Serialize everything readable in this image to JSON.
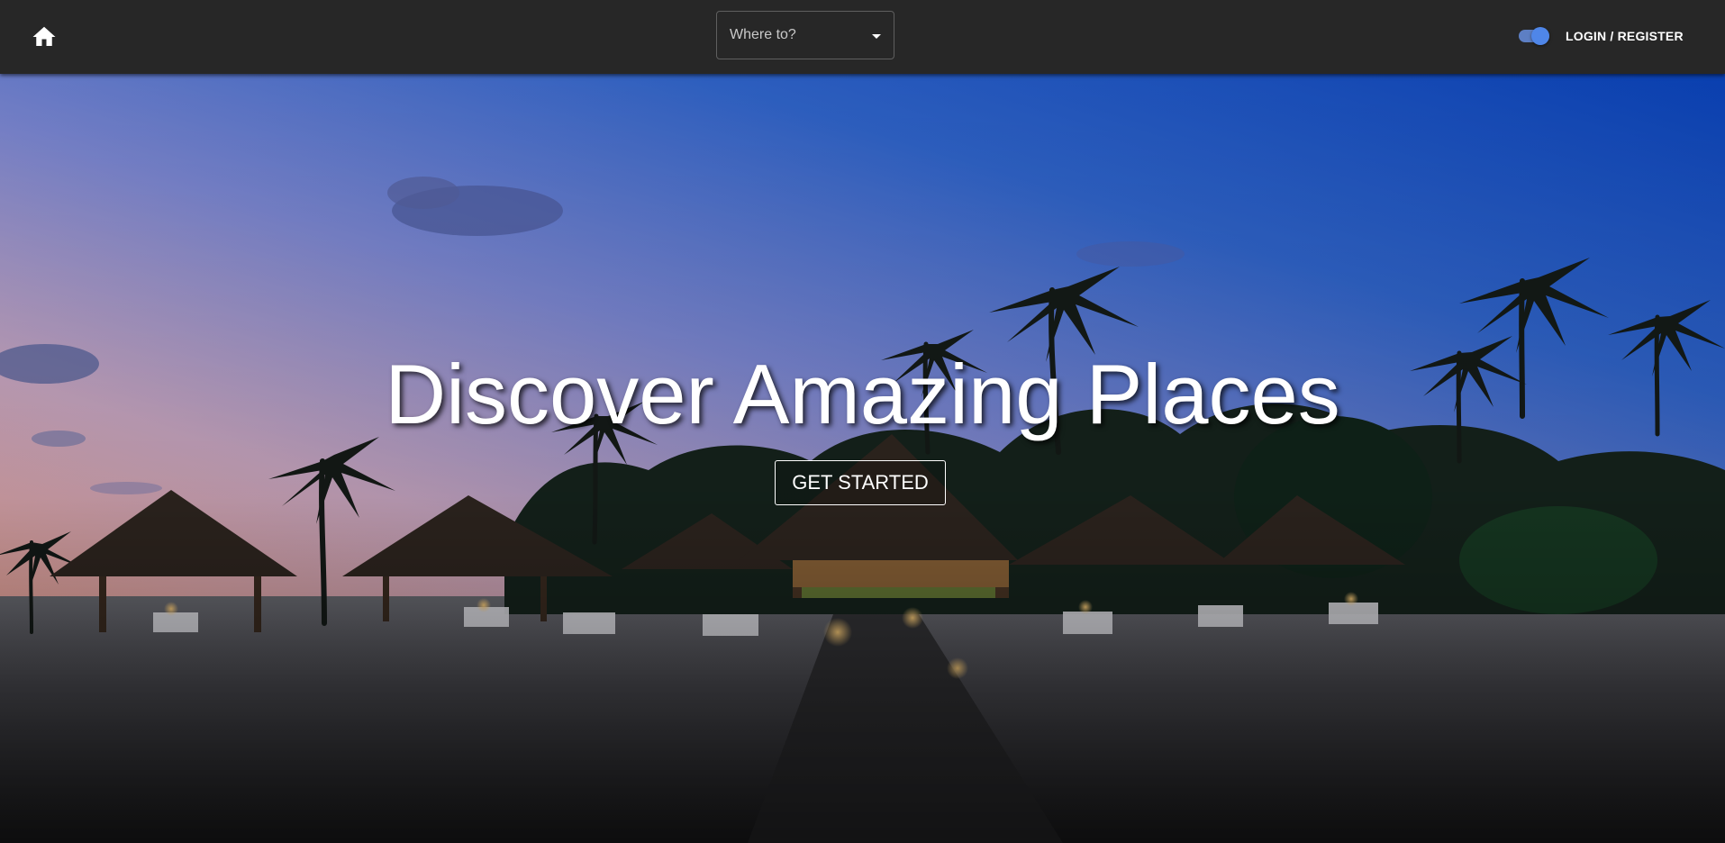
{
  "topbar": {
    "home_icon": "home-icon",
    "destination_select": {
      "placeholder": "Where to?",
      "caret_icon": "caret-down-icon"
    },
    "theme_toggle": {
      "state": "on",
      "color": "#4f86e8"
    },
    "login_label": "LOGIN / REGISTER"
  },
  "hero": {
    "title": "Discover Amazing Places",
    "cta_label": "GET STARTED",
    "background": "tropical-beach-resort-at-dusk"
  },
  "colors": {
    "topbar": "#272727",
    "accent": "#4f86e8",
    "text": "#ffffff"
  }
}
